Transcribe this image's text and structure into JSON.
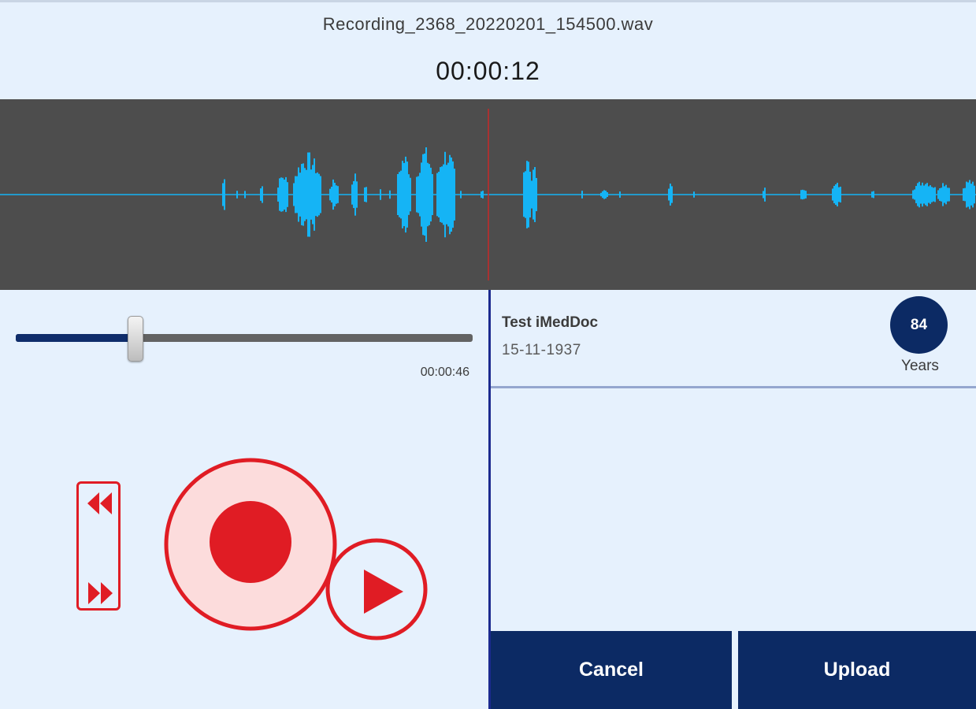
{
  "recording": {
    "filename": "Recording_2368_20220201_154500.wav",
    "elapsed_time": "00:00:12"
  },
  "waveform": {
    "color": "#15b4f5",
    "background": "#4d4d4d",
    "playhead_color": "#c62828"
  },
  "player": {
    "progress": 0.26,
    "duration": "00:00:46",
    "accent_color": "#e01c24",
    "controls": {
      "rewind_icon": "rewind-icon",
      "fast_forward_icon": "fast-forward-icon",
      "record_icon": "record-icon",
      "play_icon": "play-icon"
    }
  },
  "patient": {
    "name": "Test iMedDoc",
    "dob": "15-11-1937",
    "age": "84",
    "age_unit": "Years"
  },
  "actions": {
    "cancel_label": "Cancel",
    "upload_label": "Upload",
    "button_color": "#0c2a64"
  }
}
